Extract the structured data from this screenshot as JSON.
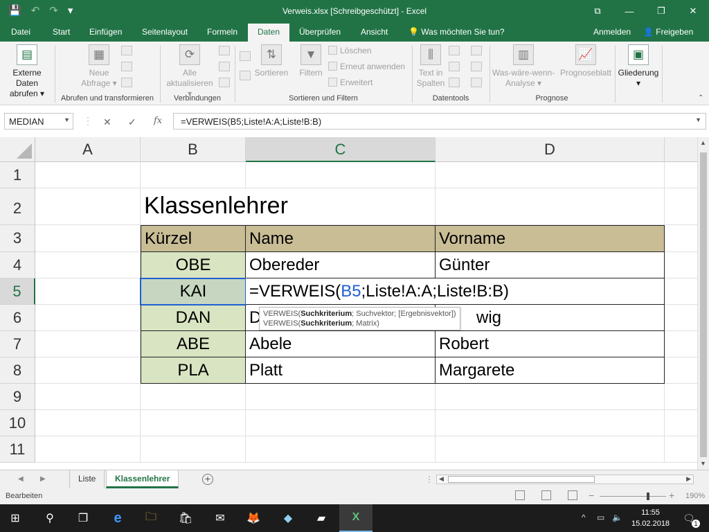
{
  "window": {
    "title": "Verweis.xlsx  [Schreibgeschützt] - Excel",
    "qat_save": "💾",
    "qat_undo": "↶",
    "qat_redo": "↷",
    "qat_customize": "▾",
    "btn_ribbon_options": "⧉",
    "btn_minimize": "—",
    "btn_restore": "❐",
    "btn_close": "✕"
  },
  "tabs": {
    "datei": "Datei",
    "start": "Start",
    "einfuegen": "Einfügen",
    "seitenlayout": "Seitenlayout",
    "formeln": "Formeln",
    "daten": "Daten",
    "ueberpruefen": "Überprüfen",
    "ansicht": "Ansicht",
    "tellme": "Was möchten Sie tun?",
    "tellme_icon": "💡",
    "signin": "Anmelden",
    "share": "Freigeben",
    "share_icon": "👤"
  },
  "ribbon": {
    "externe_daten": "Externe Daten abrufen",
    "externe_daten_l1": "Externe Daten",
    "externe_daten_l2": "abrufen ▾",
    "neue_abfrage_l1": "Neue",
    "neue_abfrage_l2": "Abfrage ▾",
    "group_abrufen": "Abrufen und transformieren",
    "alle_akt_l1": "Alle",
    "alle_akt_l2": "aktualisieren ▾",
    "group_verbindungen": "Verbindungen",
    "sortieren": "Sortieren",
    "filtern": "Filtern",
    "loeschen": "Löschen",
    "erneut": "Erneut anwenden",
    "erweitert": "Erweitert",
    "group_sortieren": "Sortieren und Filtern",
    "text_spalten_l1": "Text in",
    "text_spalten_l2": "Spalten",
    "group_datentools": "Datentools",
    "waswaere_l1": "Was-wäre-wenn-",
    "waswaere_l2": "Analyse ▾",
    "prognoseblatt": "Prognoseblatt",
    "group_prognose": "Prognose",
    "gliederung": "Gliederung",
    "gliederung_arrow": "▾"
  },
  "formula_bar": {
    "namebox": "MEDIAN",
    "cancel": "✕",
    "enter": "✓",
    "fx": "fx",
    "formula": "=VERWEIS(B5;Liste!A:A;Liste!B:B)"
  },
  "grid": {
    "columns": [
      "A",
      "B",
      "C",
      "D"
    ],
    "rows": [
      "1",
      "2",
      "3",
      "4",
      "5",
      "6",
      "7",
      "8",
      "9",
      "10",
      "11"
    ],
    "title": "Klassenlehrer",
    "headers": [
      "Kürzel",
      "Name",
      "Vorname"
    ],
    "data": [
      [
        "OBE",
        "Obereder",
        "Günter"
      ],
      [
        "KAI",
        "",
        ""
      ],
      [
        "DAN",
        "D",
        "wig"
      ],
      [
        "ABE",
        "Abele",
        "Robert"
      ],
      [
        "PLA",
        "Platt",
        "Margarete"
      ]
    ],
    "edit_prefix": "=VERWEIS(",
    "edit_ref": "B5",
    "edit_suffix": ";Liste!A:A;Liste!B:B)",
    "tooltip_1_pre": "VERWEIS(",
    "tooltip_1_bold": "Suchkriterium",
    "tooltip_1_post": "; Suchvektor; [Ergebnisvektor])",
    "tooltip_2_pre": "VERWEIS(",
    "tooltip_2_bold": "Suchkriterium",
    "tooltip_2_post": "; Matrix)"
  },
  "sheets": {
    "nav_prev": "◀",
    "nav_next": "▶",
    "tabs": [
      "Liste",
      "Klassenlehrer"
    ],
    "add": "+"
  },
  "status": {
    "mode": "Bearbeiten",
    "zoom_minus": "−",
    "zoom_plus": "+",
    "zoom": "190%"
  },
  "taskbar": {
    "start": "⊞",
    "search": "⚲",
    "taskview": "❐",
    "edge": "e",
    "explorer": "🗀",
    "store": "🛍",
    "mail": "✉",
    "firefox": "🦊",
    "app1": "◆",
    "app2": "▰",
    "excel": "X",
    "tray_up": "^",
    "tray_net": "▭",
    "tray_vol": "🔈",
    "tray_kb": "⌨",
    "time": "11:55",
    "date": "15.02.2018",
    "notif": "🗨",
    "notif_count": "1"
  },
  "colors": {
    "excel_green": "#217346",
    "header_fill": "#c9bd96",
    "kuerzel_fill": "#d9e4c2",
    "ref_blue": "#1f5fd1"
  }
}
